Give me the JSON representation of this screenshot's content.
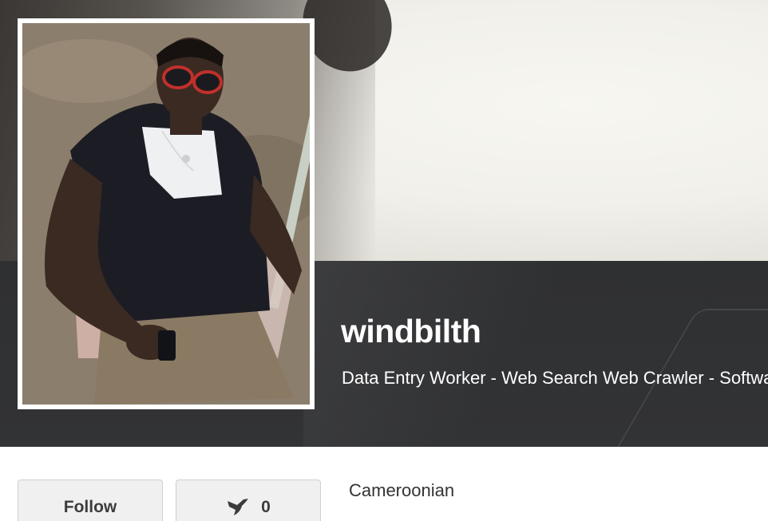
{
  "profile": {
    "username": "windbilth",
    "tagline": "Data Entry Worker - Web Search Web Crawler - Software",
    "nationality": "Cameroonian"
  },
  "actions": {
    "follow_label": "Follow",
    "appreciate_count": "0",
    "appreciate_icon": "hummingbird-icon"
  },
  "colors": {
    "banner_dark": "#323335",
    "button_bg": "#f0f0f0",
    "text_dark": "#333333"
  }
}
